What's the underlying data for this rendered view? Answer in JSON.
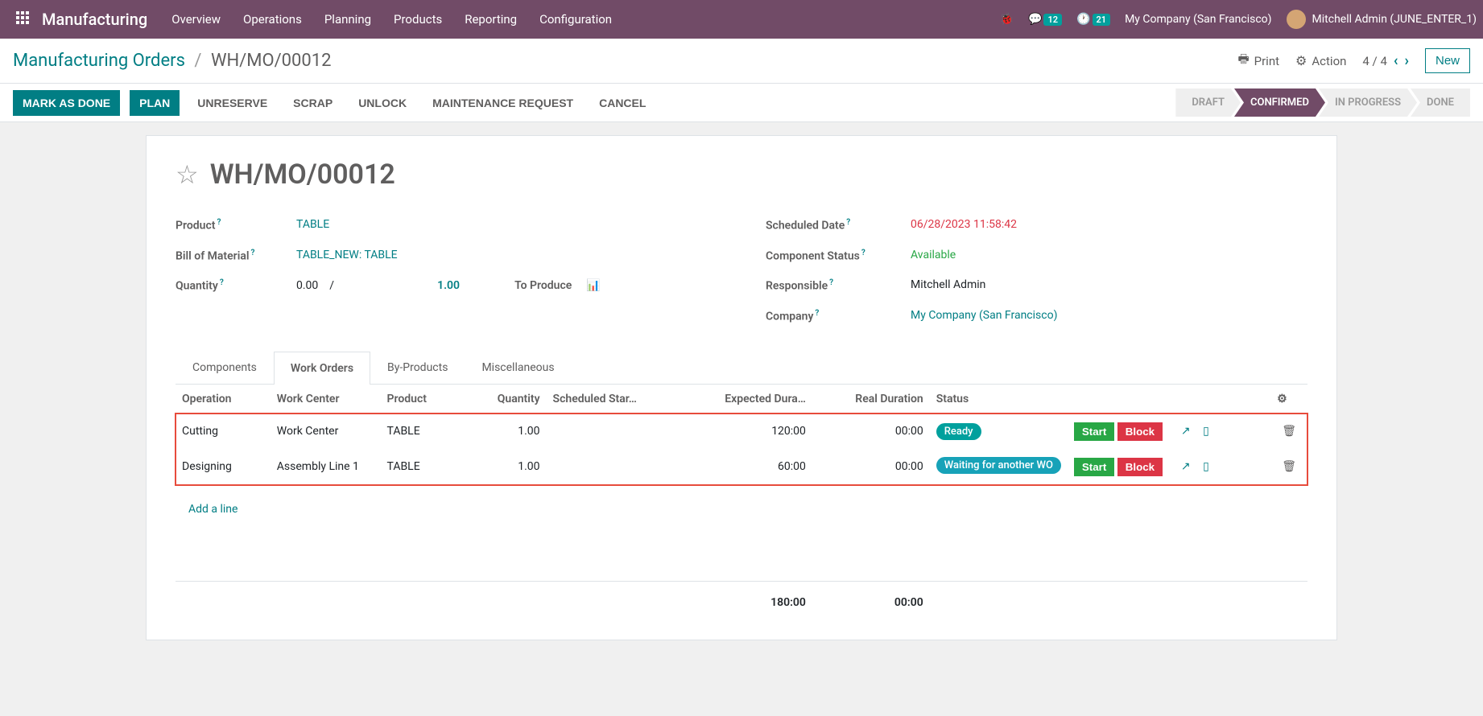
{
  "topbar": {
    "app_title": "Manufacturing",
    "menu": [
      "Overview",
      "Operations",
      "Planning",
      "Products",
      "Reporting",
      "Configuration"
    ],
    "msg_badge": "12",
    "activity_badge": "21",
    "company": "My Company (San Francisco)",
    "user": "Mitchell Admin (JUNE_ENTER_1)"
  },
  "breadcrumb": {
    "root": "Manufacturing Orders",
    "current": "WH/MO/00012",
    "print": "Print",
    "action": "Action",
    "pager": "4 / 4",
    "new": "New"
  },
  "actions": {
    "mark_done": "MARK AS DONE",
    "plan": "PLAN",
    "unreserve": "UNRESERVE",
    "scrap": "SCRAP",
    "unlock": "UNLOCK",
    "maintenance": "MAINTENANCE REQUEST",
    "cancel": "CANCEL"
  },
  "status": {
    "draft": "DRAFT",
    "confirmed": "CONFIRMED",
    "in_progress": "IN PROGRESS",
    "done": "DONE"
  },
  "form": {
    "title": "WH/MO/00012",
    "labels": {
      "product": "Product",
      "bom": "Bill of Material",
      "quantity": "Quantity",
      "scheduled": "Scheduled Date",
      "component_status": "Component Status",
      "responsible": "Responsible",
      "company": "Company",
      "to_produce": "To Produce"
    },
    "values": {
      "product": "TABLE",
      "bom": "TABLE_NEW: TABLE",
      "qty_done": "0.00",
      "qty_sep": "/",
      "qty_total": "1.00",
      "scheduled": "06/28/2023 11:58:42",
      "component_status": "Available",
      "responsible": "Mitchell Admin",
      "company": "My Company (San Francisco)"
    }
  },
  "tabs": [
    "Components",
    "Work Orders",
    "By-Products",
    "Miscellaneous"
  ],
  "table": {
    "headers": {
      "operation": "Operation",
      "work_center": "Work Center",
      "product": "Product",
      "quantity": "Quantity",
      "scheduled_start": "Scheduled Star…",
      "expected_duration": "Expected Dura…",
      "real_duration": "Real Duration",
      "status": "Status"
    },
    "rows": [
      {
        "operation": "Cutting",
        "work_center": "Work Center",
        "product": "TABLE",
        "quantity": "1.00",
        "scheduled_start": "",
        "expected_duration": "120:00",
        "real_duration": "00:00",
        "status": "Ready",
        "status_class": "pill-ready"
      },
      {
        "operation": "Designing",
        "work_center": "Assembly Line 1",
        "product": "TABLE",
        "quantity": "1.00",
        "scheduled_start": "",
        "expected_duration": "60:00",
        "real_duration": "00:00",
        "status": "Waiting for another WO",
        "status_class": "pill-waiting"
      }
    ],
    "buttons": {
      "start": "Start",
      "block": "Block"
    },
    "add_line": "Add a line",
    "footer": {
      "expected_total": "180:00",
      "real_total": "00:00"
    }
  }
}
